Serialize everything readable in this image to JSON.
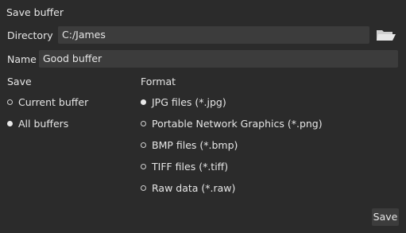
{
  "dialog": {
    "title": "Save buffer",
    "directory": {
      "label": "Directory",
      "value": "C:/James",
      "browse_icon": "folder-open-icon"
    },
    "name": {
      "label": "Name",
      "value": "Good buffer"
    },
    "save": {
      "label": "Save",
      "options": [
        {
          "label": "Current buffer",
          "selected": false
        },
        {
          "label": "All buffers",
          "selected": true
        }
      ]
    },
    "format": {
      "label": "Format",
      "options": [
        {
          "label": "JPG files (*.jpg)",
          "selected": true
        },
        {
          "label": "Portable Network Graphics (*.png)",
          "selected": false
        },
        {
          "label": "BMP files (*.bmp)",
          "selected": false
        },
        {
          "label": "TIFF files (*.tiff)",
          "selected": false
        },
        {
          "label": "Raw data (*.raw)",
          "selected": false
        }
      ]
    },
    "save_button": "Save"
  }
}
